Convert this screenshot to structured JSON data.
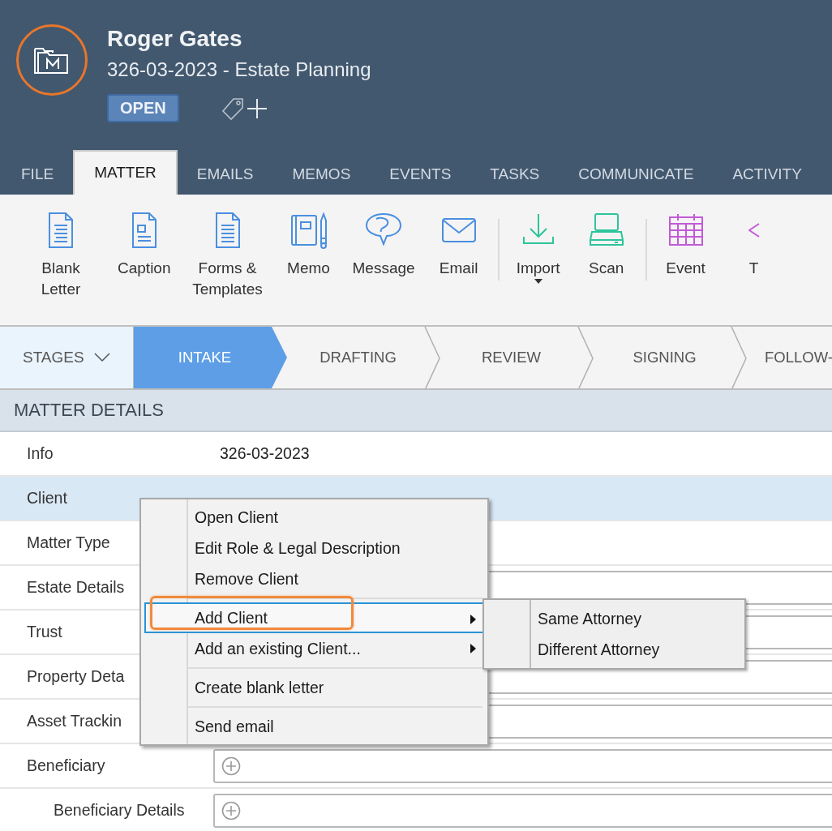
{
  "header": {
    "title": "Roger Gates",
    "subtitle": "326-03-2023 - Estate Planning",
    "status": "OPEN"
  },
  "tabs": [
    {
      "label": "FILE",
      "selected": false
    },
    {
      "label": "MATTER",
      "selected": true
    },
    {
      "label": "EMAILS",
      "selected": false
    },
    {
      "label": "MEMOS",
      "selected": false
    },
    {
      "label": "EVENTS",
      "selected": false
    },
    {
      "label": "TASKS",
      "selected": false
    },
    {
      "label": "COMMUNICATE",
      "selected": false
    },
    {
      "label": "ACTIVITY",
      "selected": false
    }
  ],
  "ribbon": {
    "groups": [
      {
        "items": [
          {
            "label": "Blank Letter",
            "dropdown": false
          },
          {
            "label": "Caption",
            "dropdown": false
          },
          {
            "label": "Forms & Templates",
            "dropdown": false
          },
          {
            "label": "Memo",
            "dropdown": false
          },
          {
            "label": "Message",
            "dropdown": false
          },
          {
            "label": "Email",
            "dropdown": false
          }
        ]
      },
      {
        "items": [
          {
            "label": "Import",
            "dropdown": true
          },
          {
            "label": "Scan",
            "dropdown": false
          }
        ]
      },
      {
        "items": [
          {
            "label": "Event",
            "dropdown": false
          },
          {
            "label": "T",
            "dropdown": false
          }
        ]
      }
    ]
  },
  "stages": {
    "label": "STAGES",
    "items": [
      {
        "label": "INTAKE",
        "selected": true
      },
      {
        "label": "DRAFTING",
        "selected": false
      },
      {
        "label": "REVIEW",
        "selected": false
      },
      {
        "label": "SIGNING",
        "selected": false
      },
      {
        "label": "FOLLOW-",
        "selected": false
      }
    ]
  },
  "details": {
    "title": "MATTER DETAILS",
    "rows": [
      {
        "label": "Info",
        "kind": "text",
        "value": "326-03-2023",
        "selected": false
      },
      {
        "label": "Client",
        "kind": "plain",
        "selected": true
      },
      {
        "label": "Matter Type",
        "kind": "plain",
        "selected": false
      },
      {
        "label": "Estate Details",
        "kind": "field",
        "selected": false
      },
      {
        "label": "Trust",
        "kind": "field",
        "selected": false
      },
      {
        "label": "Property Deta",
        "kind": "field",
        "selected": false
      },
      {
        "label": "Asset Trackin",
        "kind": "field",
        "selected": false
      },
      {
        "label": "Beneficiary",
        "kind": "add",
        "selected": false,
        "children": [
          {
            "label": "Beneficiary Details",
            "kind": "add",
            "selected": false
          }
        ]
      }
    ]
  },
  "context_menu": {
    "groups": [
      {
        "items": [
          {
            "label": "Open Client",
            "submenu": false,
            "highlighted": false,
            "annotated": false
          },
          {
            "label": "Edit Role & Legal Description",
            "submenu": false,
            "highlighted": false,
            "annotated": false
          },
          {
            "label": "Remove Client",
            "submenu": false,
            "highlighted": false,
            "annotated": false
          }
        ]
      },
      {
        "items": [
          {
            "label": "Add Client",
            "submenu": true,
            "highlighted": true,
            "annotated": true
          },
          {
            "label": "Add an existing Client...",
            "submenu": true,
            "highlighted": false,
            "annotated": false
          }
        ]
      },
      {
        "items": [
          {
            "label": "Create blank letter",
            "submenu": false,
            "highlighted": false,
            "annotated": false
          }
        ]
      },
      {
        "items": [
          {
            "label": "Send email",
            "submenu": false,
            "highlighted": false,
            "annotated": false
          }
        ]
      }
    ],
    "submenu": {
      "items": [
        {
          "label": "Same Attorney"
        },
        {
          "label": "Different Attorney"
        }
      ]
    }
  }
}
